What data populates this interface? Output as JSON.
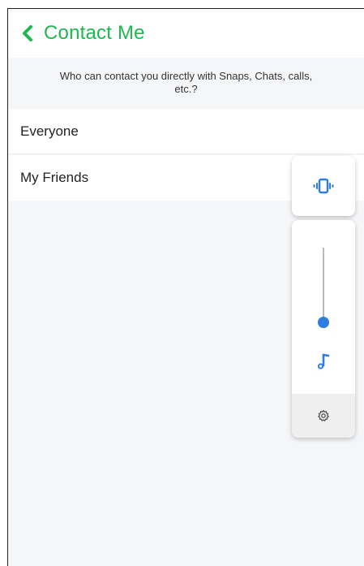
{
  "header": {
    "title": "Contact Me",
    "accent_color": "#1fb84f",
    "back_icon": "chevron-left-icon"
  },
  "description": "Who can contact you directly with Snaps, Chats, calls, etc.?",
  "options": [
    {
      "label": "Everyone"
    },
    {
      "label": "My Friends"
    }
  ],
  "volume_panel": {
    "vibrate_icon": "vibrate-icon",
    "slider_level": 0,
    "slider_color": "#2f7de1",
    "stream_icon": "music-note-icon",
    "settings_icon": "gear-icon"
  }
}
